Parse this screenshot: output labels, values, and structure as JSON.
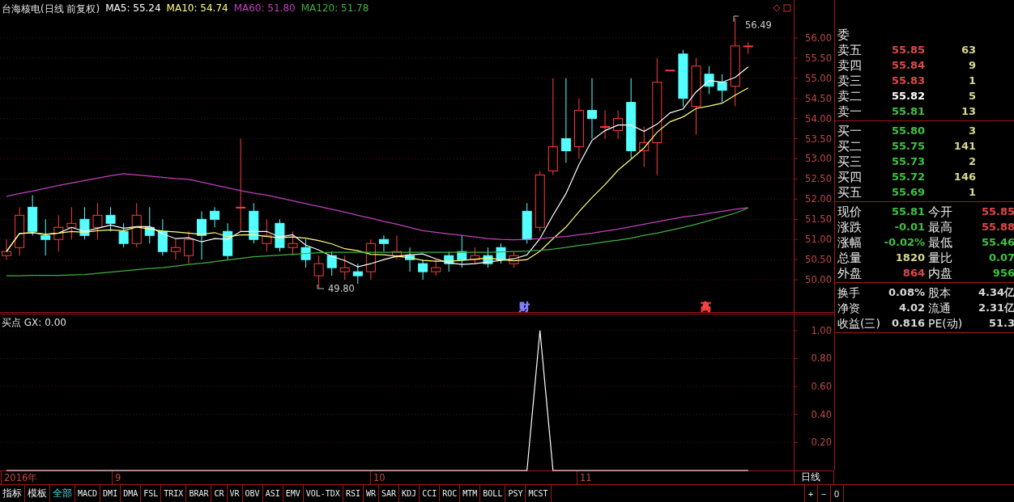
{
  "chart": {
    "title": "台海核电(日线 前复权)",
    "ma": [
      {
        "label": "MA5: 55.24",
        "color": "#ffffff"
      },
      {
        "label": "MA10: 54.74",
        "color": "#ffff80"
      },
      {
        "label": "MA60: 51.80",
        "color": "#c040c0"
      },
      {
        "label": "MA120: 51.78",
        "color": "#40b040"
      }
    ],
    "chart_data": {
      "type": "candlestick",
      "grid": true,
      "ylim": [
        49.18,
        56.94
      ],
      "yticks": [
        {
          "value": 56,
          "label": "56.00"
        },
        {
          "value": 55.5,
          "label": "55.50"
        },
        {
          "value": 55,
          "label": "55.00"
        },
        {
          "value": 54.5,
          "label": "54.50"
        },
        {
          "value": 54,
          "label": "54.00"
        },
        {
          "value": 53.5,
          "label": "53.50"
        },
        {
          "value": 53,
          "label": "53.00"
        },
        {
          "value": 52.5,
          "label": "52.50"
        },
        {
          "value": 52,
          "label": "52.00"
        },
        {
          "value": 51.5,
          "label": "51.50"
        },
        {
          "value": 51,
          "label": "51.00"
        },
        {
          "value": 50.5,
          "label": "50.50"
        },
        {
          "value": 50,
          "label": "50.00"
        }
      ],
      "ohlc": [
        [
          50.6,
          51,
          50.5,
          50.7
        ],
        [
          50.8,
          51.8,
          50.6,
          51.6
        ],
        [
          51.8,
          52.1,
          51.1,
          51.2
        ],
        [
          51.1,
          51.5,
          50.6,
          51
        ],
        [
          51,
          51.6,
          50.7,
          51.3
        ],
        [
          51.3,
          51.8,
          51,
          51.4
        ],
        [
          51.5,
          51.8,
          51,
          51.1
        ],
        [
          51.3,
          51.9,
          51,
          51.6
        ],
        [
          51.6,
          51.8,
          51.2,
          51.4
        ],
        [
          51.2,
          51.4,
          50.8,
          50.9
        ],
        [
          50.9,
          51.9,
          50.8,
          51.6
        ],
        [
          51.3,
          51.8,
          50.9,
          51.1
        ],
        [
          51.2,
          51.5,
          50.6,
          50.7
        ],
        [
          50.7,
          51,
          50.5,
          50.8
        ],
        [
          50.6,
          51.2,
          50.4,
          51
        ],
        [
          51.5,
          51.7,
          50.5,
          51.1
        ],
        [
          51.7,
          51.8,
          51.3,
          51.5
        ],
        [
          51.2,
          51.4,
          50.5,
          50.6
        ],
        [
          51.8,
          53.5,
          51.2,
          51.8
        ],
        [
          51.7,
          51.9,
          50.9,
          51
        ],
        [
          50.9,
          51.5,
          50.7,
          51.1
        ],
        [
          51.4,
          51.5,
          50.7,
          50.8
        ],
        [
          50.8,
          51.2,
          50.6,
          50.9
        ],
        [
          50.8,
          51,
          50.3,
          50.5
        ],
        [
          50.1,
          50.6,
          49.8,
          50.4
        ],
        [
          50.6,
          50.7,
          50.1,
          50.3
        ],
        [
          50.2,
          50.6,
          50,
          50.3
        ],
        [
          50.2,
          50.4,
          49.9,
          50.1
        ],
        [
          50.2,
          51,
          50,
          50.9
        ],
        [
          51,
          51.1,
          50.7,
          50.9
        ],
        [
          50.6,
          51.1,
          50.5,
          50.7
        ],
        [
          50.6,
          50.8,
          50.2,
          50.5
        ],
        [
          50.4,
          50.5,
          50,
          50.2
        ],
        [
          50.2,
          50.5,
          50.1,
          50.3
        ],
        [
          50.6,
          50.7,
          50.2,
          50.4
        ],
        [
          50.7,
          51.1,
          50.3,
          50.5
        ],
        [
          50.5,
          50.8,
          50.4,
          50.6
        ],
        [
          50.6,
          50.8,
          50.3,
          50.4
        ],
        [
          50.8,
          50.9,
          50.4,
          50.5
        ],
        [
          50.4,
          50.7,
          50.3,
          50.6
        ],
        [
          51.7,
          51.9,
          50.9,
          51
        ],
        [
          51.3,
          52.7,
          51.2,
          52.6
        ],
        [
          52.7,
          55,
          52.6,
          53.3
        ],
        [
          53.5,
          55,
          52.9,
          53.2
        ],
        [
          53.3,
          54.5,
          53,
          54.2
        ],
        [
          54.2,
          55,
          53.5,
          54
        ],
        [
          53.8,
          54.2,
          53.5,
          53.8
        ],
        [
          53.7,
          54.2,
          53.5,
          54
        ],
        [
          54.4,
          55,
          53,
          53.2
        ],
        [
          53.2,
          53.8,
          52.8,
          53.4
        ],
        [
          53.4,
          55.5,
          52.6,
          54.9
        ],
        [
          55.2,
          55.2,
          55.2,
          55.2
        ],
        [
          55.6,
          55.7,
          54.3,
          54.5
        ],
        [
          54.3,
          55.5,
          53.6,
          55.3
        ],
        [
          55.1,
          55.3,
          54.6,
          54.8
        ],
        [
          54.9,
          55.1,
          54.4,
          54.7
        ],
        [
          54.8,
          56.49,
          54.3,
          55.8
        ],
        [
          55.8,
          55.9,
          55.6,
          55.8
        ],
        null,
        null,
        null
      ],
      "series": [
        {
          "type": "line",
          "color": "#ffffff",
          "values": [
            50.7,
            51.15,
            51.17,
            51.13,
            51.16,
            51.3,
            51.2,
            51.28,
            51.36,
            51.28,
            51.32,
            51.32,
            51.14,
            51.02,
            51.04,
            50.94,
            51.02,
            51.0,
            51.2,
            51.2,
            51.2,
            51.06,
            51.12,
            50.86,
            50.74,
            50.58,
            50.48,
            50.32,
            50.4,
            50.5,
            50.58,
            50.62,
            50.64,
            50.52,
            50.42,
            50.38,
            50.4,
            50.44,
            50.48,
            50.52,
            50.62,
            51.02,
            51.6,
            52.14,
            52.86,
            53.46,
            53.7,
            53.84,
            53.84,
            53.68,
            53.86,
            54.14,
            54.24,
            54.66,
            54.94,
            54.9,
            55.02,
            55.28,
            null,
            null,
            null
          ]
        },
        {
          "type": "line",
          "color": "#ffff80",
          "values": [
            50.7,
            51.15,
            51.17,
            51.13,
            51.16,
            51.2,
            51.18,
            51.22,
            51.24,
            51.22,
            51.31,
            51.26,
            51.21,
            51.19,
            51.16,
            51.13,
            51.17,
            51.07,
            51.11,
            51.12,
            51.07,
            51.04,
            51.06,
            51.03,
            50.97,
            50.89,
            50.77,
            50.72,
            50.63,
            50.62,
            50.58,
            50.55,
            50.48,
            50.46,
            50.46,
            50.48,
            50.51,
            50.54,
            50.5,
            50.47,
            50.5,
            50.71,
            51.02,
            51.31,
            51.69,
            52.04,
            52.36,
            52.72,
            52.99,
            53.27,
            53.66,
            53.92,
            54.04,
            54.25,
            54.31,
            54.38,
            54.58,
            54.76,
            null,
            null,
            null
          ]
        },
        {
          "type": "line",
          "color": "#c040c0",
          "values": [
            52.07,
            52.14,
            52.2,
            52.27,
            52.34,
            52.4,
            52.46,
            52.52,
            52.58,
            52.63,
            52.6,
            52.57,
            52.54,
            52.51,
            52.49,
            52.42,
            52.35,
            52.28,
            52.21,
            52.15,
            52.1,
            52.03,
            51.96,
            51.89,
            51.82,
            51.75,
            51.68,
            51.6,
            51.53,
            51.45,
            51.38,
            51.3,
            51.22,
            51.18,
            51.14,
            51.1,
            51.06,
            51.02,
            51.0,
            50.99,
            51.0,
            51.02,
            51.05,
            51.07,
            51.12,
            51.16,
            51.21,
            51.26,
            51.32,
            51.38,
            51.44,
            51.5,
            51.56,
            51.6,
            51.65,
            51.7,
            51.75,
            51.79,
            null,
            null,
            null
          ]
        },
        {
          "type": "line",
          "color": "#40b040",
          "values": [
            50.1,
            50.1,
            50.11,
            50.11,
            50.11,
            50.12,
            50.13,
            50.16,
            50.19,
            50.22,
            50.25,
            50.28,
            50.3,
            50.34,
            50.38,
            50.41,
            50.45,
            50.49,
            50.53,
            50.57,
            50.59,
            50.61,
            50.63,
            50.65,
            50.67,
            50.68,
            50.68,
            50.68,
            50.68,
            50.68,
            50.68,
            50.68,
            50.68,
            50.68,
            50.68,
            50.68,
            50.68,
            50.68,
            50.69,
            50.7,
            50.71,
            50.73,
            50.76,
            50.8,
            50.85,
            50.89,
            50.94,
            50.98,
            51.03,
            51.1,
            51.16,
            51.23,
            51.3,
            51.38,
            51.47,
            51.56,
            51.65,
            51.78,
            null,
            null,
            null
          ]
        }
      ]
    },
    "high_label": "56.49",
    "low_label": "49.80",
    "markers": [
      {
        "text": "财",
        "color": "#8080ff"
      },
      {
        "text": "高",
        "color": "#ff4040"
      }
    ]
  },
  "indicator": {
    "label": "买点 GX: 0.00",
    "chart_data": {
      "type": "line",
      "grid": true,
      "ylim": [
        0,
        1.12
      ],
      "yticks": [
        {
          "value": 1,
          "label": "1.00"
        },
        {
          "value": 0.8,
          "label": "0.80"
        },
        {
          "value": 0.6,
          "label": "0.60"
        },
        {
          "value": 0.4,
          "label": "0.40"
        },
        {
          "value": 0.2,
          "label": "0.20"
        }
      ],
      "series": [
        {
          "color": "#ffffff",
          "values": [
            0,
            0,
            0,
            0,
            0,
            0,
            0,
            0,
            0,
            0,
            0,
            0,
            0,
            0,
            0,
            0,
            0,
            0,
            0,
            0,
            0,
            0,
            0,
            0,
            0,
            0,
            0,
            0,
            0,
            0,
            0,
            0,
            0,
            0,
            0,
            0,
            0,
            0,
            0,
            0,
            0,
            1,
            0,
            0,
            0,
            0,
            0,
            0,
            0,
            0,
            0,
            0,
            0,
            0,
            0,
            0,
            0,
            0,
            null,
            null,
            null
          ]
        }
      ]
    }
  },
  "date_axis": [
    "2016年",
    "9",
    "10",
    "11"
  ],
  "period": "日线",
  "zoom_buttons": [
    "+",
    "−",
    "0"
  ],
  "tabs": [
    {
      "label": "指标",
      "selected": false
    },
    {
      "label": "模板",
      "selected": false
    },
    {
      "label": "全部",
      "selected": true
    },
    {
      "label": "MACD",
      "selected": false
    },
    {
      "label": "DMI",
      "selected": false
    },
    {
      "label": "DMA",
      "selected": false
    },
    {
      "label": "FSL",
      "selected": false
    },
    {
      "label": "TRIX",
      "selected": false
    },
    {
      "label": "BRAR",
      "selected": false
    },
    {
      "label": "CR",
      "selected": false
    },
    {
      "label": "VR",
      "selected": false
    },
    {
      "label": "OBV",
      "selected": false
    },
    {
      "label": "ASI",
      "selected": false
    },
    {
      "label": "EMV",
      "selected": false
    },
    {
      "label": "VOL-TDX",
      "selected": false
    },
    {
      "label": "RSI",
      "selected": false
    },
    {
      "label": "WR",
      "selected": false
    },
    {
      "label": "SAR",
      "selected": false
    },
    {
      "label": "KDJ",
      "selected": false
    },
    {
      "label": "CCI",
      "selected": false
    },
    {
      "label": "ROC",
      "selected": false
    },
    {
      "label": "MTM",
      "selected": false
    },
    {
      "label": "BOLL",
      "selected": false
    },
    {
      "label": "PSY",
      "selected": false
    },
    {
      "label": "MCST",
      "selected": false
    }
  ],
  "quote": {
    "ratio_label": "委",
    "asks": [
      {
        "label": "卖五",
        "price": "55.85",
        "volume": "63",
        "color": "#e04848"
      },
      {
        "label": "卖四",
        "price": "55.84",
        "volume": "9",
        "color": "#e04848"
      },
      {
        "label": "卖三",
        "price": "55.83",
        "volume": "1",
        "color": "#e04848"
      },
      {
        "label": "卖二",
        "price": "55.82",
        "volume": "5",
        "color": "#ffffff"
      },
      {
        "label": "卖一",
        "price": "55.81",
        "volume": "13",
        "color": "#40c040"
      }
    ],
    "bids": [
      {
        "label": "买一",
        "price": "55.80",
        "volume": "3",
        "color": "#40c040"
      },
      {
        "label": "买二",
        "price": "55.75",
        "volume": "141",
        "color": "#40c040"
      },
      {
        "label": "买三",
        "price": "55.73",
        "volume": "2",
        "color": "#40c040"
      },
      {
        "label": "买四",
        "price": "55.72",
        "volume": "146",
        "color": "#40c040"
      },
      {
        "label": "买五",
        "price": "55.69",
        "volume": "1",
        "color": "#40c040"
      }
    ],
    "stats": [
      {
        "label": "现价",
        "value": "55.81",
        "color": "#40c040"
      },
      {
        "label": "今开",
        "value": "55.85",
        "color": "#e04848"
      },
      {
        "label": "涨跌",
        "value": "-0.01",
        "color": "#40c040"
      },
      {
        "label": "最高",
        "value": "55.88",
        "color": "#e04848"
      },
      {
        "label": "涨幅",
        "value": "-0.02%",
        "color": "#40c040"
      },
      {
        "label": "最低",
        "value": "55.46",
        "color": "#40c040"
      },
      {
        "label": "总量",
        "value": "1820",
        "color": "#d8d890"
      },
      {
        "label": "量比",
        "value": "0.07",
        "color": "#40c040"
      },
      {
        "label": "外盘",
        "value": "864",
        "color": "#e04848"
      },
      {
        "label": "内盘",
        "value": "956",
        "color": "#40c040"
      }
    ],
    "info": [
      {
        "label": "换手",
        "value": "0.08%"
      },
      {
        "label": "股本",
        "value": "4.34亿"
      },
      {
        "label": "净资",
        "value": "4.02"
      },
      {
        "label": "流通",
        "value": "2.31亿"
      },
      {
        "label": "收益(三)",
        "value": "0.816"
      },
      {
        "label": "PE(动)",
        "value": "51.3"
      }
    ]
  }
}
